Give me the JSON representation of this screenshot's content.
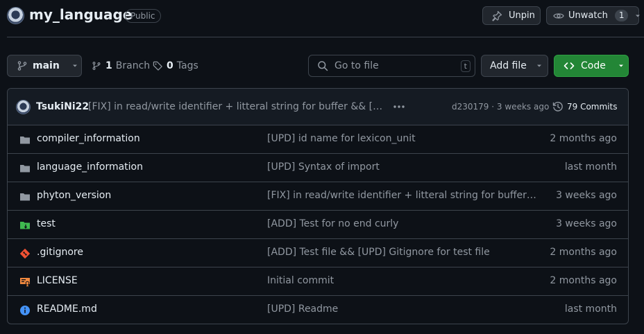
{
  "repo": {
    "name": "my_language",
    "visibility": "Public"
  },
  "actions": {
    "unpin_label": "Unpin",
    "unwatch_label": "Unwatch",
    "watch_count": "1"
  },
  "toolbar": {
    "branch_name": "main",
    "branch_count": "1",
    "branch_label": "Branch",
    "tag_count": "0",
    "tag_label": "Tags",
    "search_placeholder": "Go to file",
    "search_shortcut": "t",
    "add_file_label": "Add file",
    "code_label": "Code"
  },
  "commit": {
    "author": "TsukiNi22",
    "message": "[FIX] in read/write identifier + litteral string for buffer && [ADD] ...",
    "sha": "d230179",
    "age": "3 weeks ago",
    "count_label": "79 Commits"
  },
  "files": [
    {
      "name": "compiler_information",
      "type": "folder",
      "message": "[UPD] id name for lexicon_unit",
      "age": "2 months ago"
    },
    {
      "name": "language_information",
      "type": "folder",
      "message": "[UPD] Syntax of import",
      "age": "last month"
    },
    {
      "name": "phyton_version",
      "type": "folder",
      "message": "[FIX] in read/write identifier + litteral string for buffer &&...",
      "age": "3 weeks ago"
    },
    {
      "name": "test",
      "type": "submodule-folder",
      "message": "[ADD] Test for no end curly",
      "age": "3 weeks ago"
    },
    {
      "name": ".gitignore",
      "type": "git-file",
      "message": "[ADD] Test file && [UPD] Gitignore for test file",
      "age": "2 months ago"
    },
    {
      "name": "LICENSE",
      "type": "license-file",
      "message": "Initial commit",
      "age": "2 months ago"
    },
    {
      "name": "README.md",
      "type": "info-file",
      "message": "[UPD] Readme",
      "age": "last month"
    }
  ],
  "colors": {
    "background": "#0d1117",
    "border": "#3d444d",
    "code_button": "#238636",
    "folder_icon": "#9198a1",
    "test_folder_icon": "#3fb950",
    "gitignore_icon": "#f05133",
    "license_icon": "#f0883e",
    "readme_icon": "#4493f8"
  }
}
